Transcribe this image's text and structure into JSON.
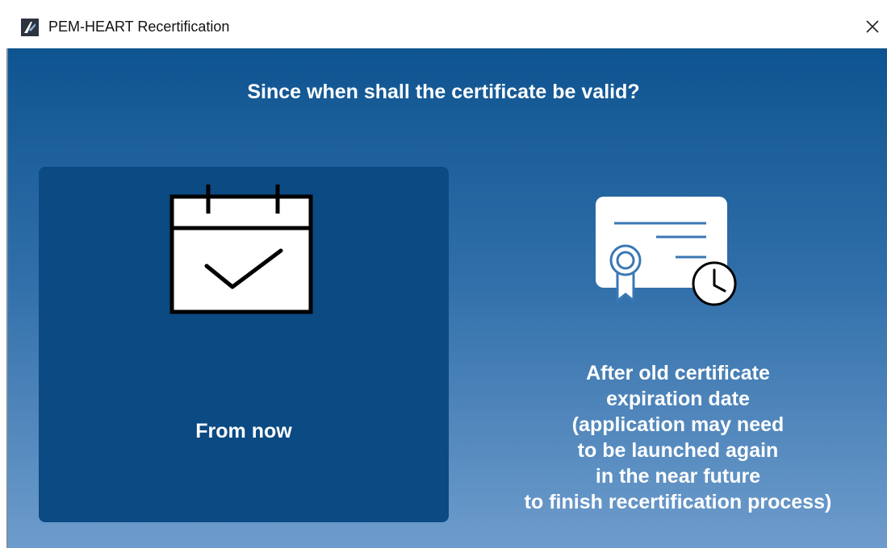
{
  "window": {
    "title": "PEM-HEART Recertification",
    "app_icon": "pem-heart-app-icon",
    "close_icon": "close-icon",
    "close_glyph": "✕"
  },
  "dialog": {
    "question": "Since when shall the certificate be valid?",
    "options": [
      {
        "icon": "calendar-check-icon",
        "label": "From now",
        "selected": true
      },
      {
        "icon": "certificate-clock-icon",
        "label_lines": [
          "After old certificate",
          "expiration date",
          "(application may need",
          "to be launched again",
          "in the near future",
          "to finish recertification process)"
        ],
        "selected": false
      }
    ]
  },
  "colors": {
    "gradient_top": "#0e5490",
    "gradient_bottom": "#6e9ccc",
    "selected_card": "#0b4a83",
    "text": "#ffffff"
  }
}
